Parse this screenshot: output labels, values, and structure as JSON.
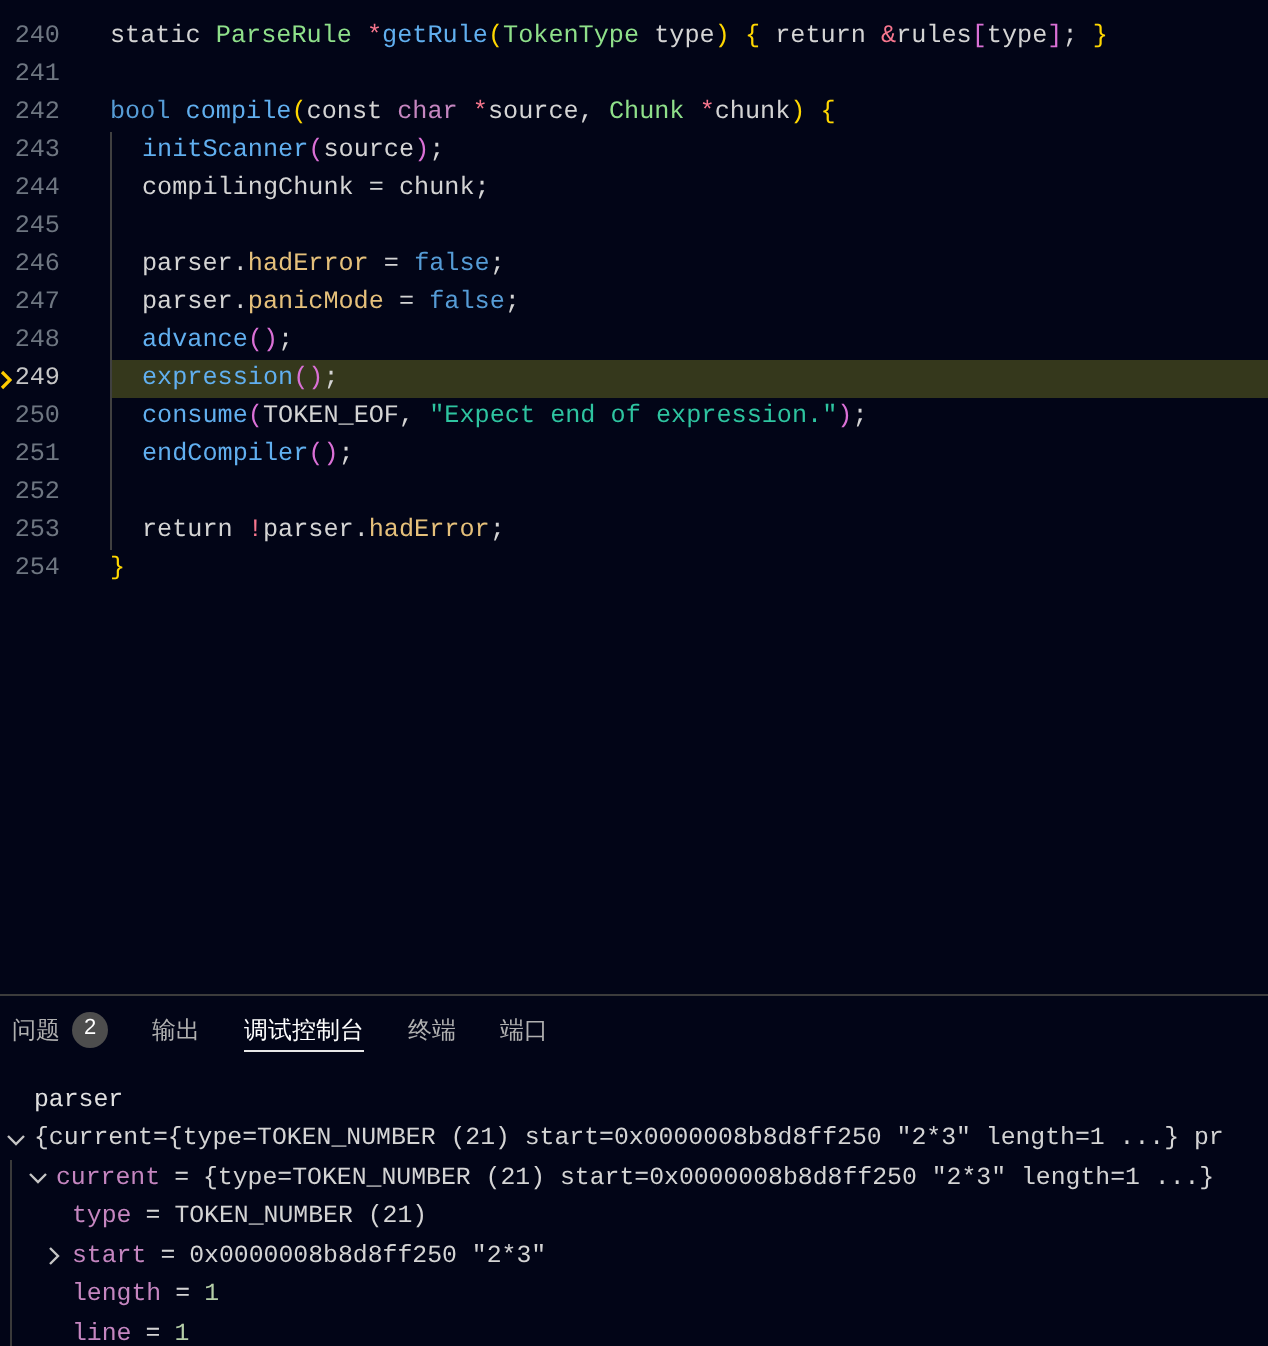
{
  "editor": {
    "lines": [
      {
        "number": "240",
        "current": false,
        "tokens": [
          {
            "t": "static ",
            "kind": "plain"
          },
          {
            "t": "ParseRule ",
            "kind": "type"
          },
          {
            "t": "*",
            "kind": "op"
          },
          {
            "t": "getRule",
            "kind": "func"
          },
          {
            "t": "(",
            "kind": "b1"
          },
          {
            "t": "TokenType",
            "kind": "type"
          },
          {
            "t": " type",
            "kind": "plain"
          },
          {
            "t": ") ",
            "kind": "b1"
          },
          {
            "t": "{",
            "kind": "b1"
          },
          {
            "t": " return ",
            "kind": "plain"
          },
          {
            "t": "&",
            "kind": "op"
          },
          {
            "t": "rules",
            "kind": "plain"
          },
          {
            "t": "[",
            "kind": "b2"
          },
          {
            "t": "type",
            "kind": "plain"
          },
          {
            "t": "]",
            "kind": "b2"
          },
          {
            "t": "; ",
            "kind": "plain"
          },
          {
            "t": "}",
            "kind": "b1"
          }
        ]
      },
      {
        "number": "241",
        "current": false
      },
      {
        "number": "242",
        "current": false,
        "tokens": [
          {
            "t": "bool ",
            "kind": "keyword"
          },
          {
            "t": "compile",
            "kind": "func"
          },
          {
            "t": "(",
            "kind": "b1"
          },
          {
            "t": "const ",
            "kind": "plain"
          },
          {
            "t": "char ",
            "kind": "storage"
          },
          {
            "t": "*",
            "kind": "op"
          },
          {
            "t": "source, ",
            "kind": "plain"
          },
          {
            "t": "Chunk ",
            "kind": "type"
          },
          {
            "t": "*",
            "kind": "op"
          },
          {
            "t": "chunk",
            "kind": "plain"
          },
          {
            "t": ") ",
            "kind": "b1"
          },
          {
            "t": "{",
            "kind": "b1"
          }
        ]
      },
      {
        "number": "243",
        "current": false,
        "guide": true,
        "tokens": [
          {
            "t": "initScanner",
            "kind": "func"
          },
          {
            "t": "(",
            "kind": "b2"
          },
          {
            "t": "source",
            "kind": "plain"
          },
          {
            "t": ")",
            "kind": "b2"
          },
          {
            "t": ";",
            "kind": "plain"
          }
        ]
      },
      {
        "number": "244",
        "current": false,
        "guide": true,
        "tokens": [
          {
            "t": "compilingChunk = chunk;",
            "kind": "plain"
          }
        ]
      },
      {
        "number": "245",
        "current": false,
        "guide": true
      },
      {
        "number": "246",
        "current": false,
        "guide": true,
        "tokens": [
          {
            "t": "parser.",
            "kind": "plain"
          },
          {
            "t": "hadError",
            "kind": "prop"
          },
          {
            "t": " = ",
            "kind": "plain"
          },
          {
            "t": "false",
            "kind": "keyword"
          },
          {
            "t": ";",
            "kind": "plain"
          }
        ]
      },
      {
        "number": "247",
        "current": false,
        "guide": true,
        "tokens": [
          {
            "t": "parser.",
            "kind": "plain"
          },
          {
            "t": "panicMode",
            "kind": "prop"
          },
          {
            "t": " = ",
            "kind": "plain"
          },
          {
            "t": "false",
            "kind": "keyword"
          },
          {
            "t": ";",
            "kind": "plain"
          }
        ]
      },
      {
        "number": "248",
        "current": false,
        "guide": true,
        "tokens": [
          {
            "t": "advance",
            "kind": "func"
          },
          {
            "t": "()",
            "kind": "b2"
          },
          {
            "t": ";",
            "kind": "plain"
          }
        ]
      },
      {
        "number": "249",
        "current": true,
        "guide": true,
        "tokens": [
          {
            "t": "expression",
            "kind": "func"
          },
          {
            "t": "()",
            "kind": "b2"
          },
          {
            "t": ";",
            "kind": "plain"
          }
        ]
      },
      {
        "number": "250",
        "current": false,
        "guide": true,
        "tokens": [
          {
            "t": "consume",
            "kind": "func"
          },
          {
            "t": "(",
            "kind": "b2"
          },
          {
            "t": "TOKEN_EOF, ",
            "kind": "plain"
          },
          {
            "t": "\"Expect end of expression.\"",
            "kind": "string"
          },
          {
            "t": ")",
            "kind": "b2"
          },
          {
            "t": ";",
            "kind": "plain"
          }
        ]
      },
      {
        "number": "251",
        "current": false,
        "guide": true,
        "tokens": [
          {
            "t": "endCompiler",
            "kind": "func"
          },
          {
            "t": "()",
            "kind": "b2"
          },
          {
            "t": ";",
            "kind": "plain"
          }
        ]
      },
      {
        "number": "252",
        "current": false,
        "guide": true
      },
      {
        "number": "253",
        "current": false,
        "guide": true,
        "tokens": [
          {
            "t": "return ",
            "kind": "plain"
          },
          {
            "t": "!",
            "kind": "op"
          },
          {
            "t": "parser.",
            "kind": "plain"
          },
          {
            "t": "hadError",
            "kind": "prop"
          },
          {
            "t": ";",
            "kind": "plain"
          }
        ]
      },
      {
        "number": "254",
        "current": false,
        "tokens": [
          {
            "t": "}",
            "kind": "b1"
          }
        ]
      }
    ]
  },
  "panel": {
    "tabs": [
      {
        "label": "问题",
        "badge": "2",
        "selected": false
      },
      {
        "label": "输出",
        "selected": false
      },
      {
        "label": "调试控制台",
        "selected": true
      },
      {
        "label": "终端",
        "selected": false
      },
      {
        "label": "端口",
        "selected": false
      }
    ],
    "console": {
      "input": "parser",
      "tree": [
        {
          "value": "{current={type=TOKEN_NUMBER (21) start=0x0000008b8d8ff250 \"2*3\" length=1 ...} pr",
          "kind": "text",
          "expanded": true,
          "children": [
            {
              "name": "current",
              "sep": "=",
              "value": "{type=TOKEN_NUMBER (21) start=0x0000008b8d8ff250 \"2*3\" length=1 ...}",
              "kind": "text",
              "expanded": true,
              "children": [
                {
                  "name": "type",
                  "sep": "=",
                  "value": "TOKEN_NUMBER (21)",
                  "kind": "text"
                },
                {
                  "name": "start",
                  "sep": "=",
                  "value": "0x0000008b8d8ff250 \"2*3\"",
                  "kind": "text",
                  "expanded": false
                },
                {
                  "name": "length",
                  "sep": "=",
                  "value": "1",
                  "kind": "number"
                },
                {
                  "name": "line",
                  "sep": "=",
                  "value": "1",
                  "kind": "number"
                }
              ]
            }
          ]
        }
      ]
    }
  }
}
